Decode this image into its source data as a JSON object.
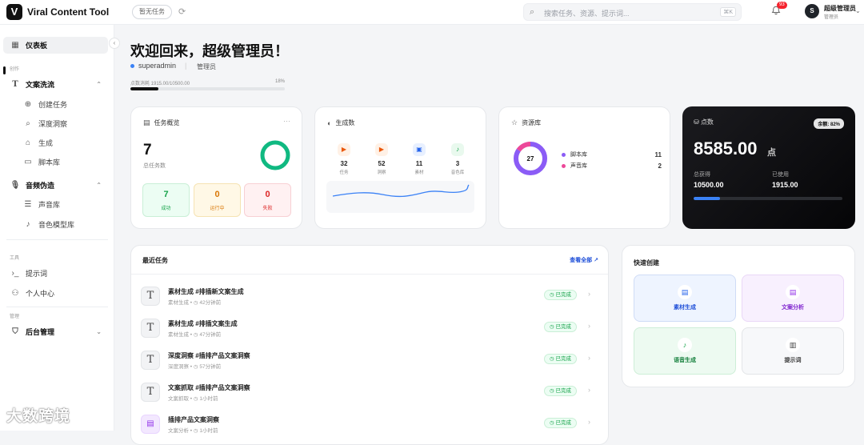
{
  "app": {
    "title": "Viral Content Tool",
    "logo_letter": "V"
  },
  "topbar": {
    "no_task_label": "暂无任务",
    "search_placeholder": "搜索任务、资源、提示词...",
    "search_shortcut": "⌘K",
    "notification_count": "93",
    "user": {
      "avatar_letter": "S",
      "name": "超级管理员",
      "role": "管理员"
    }
  },
  "sidebar": {
    "dashboard": "仪表板",
    "section_create": "创作",
    "group_copy": "文案洗流",
    "copy_items": [
      "创建任务",
      "深度洞察",
      "生成",
      "脚本库"
    ],
    "group_audio": "音频伪造",
    "audio_items": [
      "声音库",
      "音色模型库"
    ],
    "section_tools": "工具",
    "tools_items": [
      "提示词",
      "个人中心"
    ],
    "section_admin": "管理",
    "admin": "后台管理"
  },
  "watermark": "大数跨境",
  "welcome": {
    "title": "欢迎回来，超级管理员！",
    "username": "superadmin",
    "role": "管理员",
    "points_label": "点数消耗 1915.00/10500.00",
    "points_pct": "18%",
    "points_ratio": 0.18
  },
  "task_overview": {
    "title": "任务概览",
    "total": "7",
    "total_label": "总任务数",
    "success_ratio": 1.0,
    "success": {
      "value": "7",
      "label": "成功"
    },
    "running": {
      "value": "0",
      "label": "运行中"
    },
    "failed": {
      "value": "0",
      "label": "失败"
    }
  },
  "generation": {
    "title": "生成数",
    "items": [
      {
        "value": "32",
        "label": "任务"
      },
      {
        "value": "52",
        "label": "洞察"
      },
      {
        "value": "11",
        "label": "素材"
      },
      {
        "value": "3",
        "label": "音色库"
      }
    ]
  },
  "resources": {
    "title": "资源库",
    "total": "27",
    "items": [
      {
        "label": "脚本库",
        "value": "11",
        "color": "#8b5cf6"
      },
      {
        "label": "声音库",
        "value": "2",
        "color": "#ec4899"
      }
    ]
  },
  "points": {
    "title": "点数",
    "balance_badge": "余额: 82%",
    "balance": "8585.00",
    "unit": "点",
    "earned_label": "总获得",
    "earned": "10500.00",
    "used_label": "已使用",
    "used": "1915.00",
    "used_ratio": 0.18
  },
  "recent": {
    "title": "最近任务",
    "view_all": "查看全部",
    "tasks": [
      {
        "name": "素材生成 #排插新文案生成",
        "type": "素材生成",
        "time": "42分钟前",
        "status": "已完成"
      },
      {
        "name": "素材生成 #排插文案生成",
        "type": "素材生成",
        "time": "47分钟前",
        "status": "已完成"
      },
      {
        "name": "深度洞察 #插排产品文案洞察",
        "type": "深度洞察",
        "time": "57分钟前",
        "status": "已完成"
      },
      {
        "name": "文案抓取 #插排产品文案洞察",
        "type": "文案抓取",
        "time": "1小时前",
        "status": "已完成"
      },
      {
        "name": "插排产品文案洞察",
        "type": "文案分析",
        "time": "1小时前",
        "status": "已完成"
      }
    ]
  },
  "quick": {
    "title": "快速创建",
    "items": [
      {
        "label": "素材生成"
      },
      {
        "label": "文案分析"
      },
      {
        "label": "语音生成"
      },
      {
        "label": "提示词"
      }
    ]
  }
}
